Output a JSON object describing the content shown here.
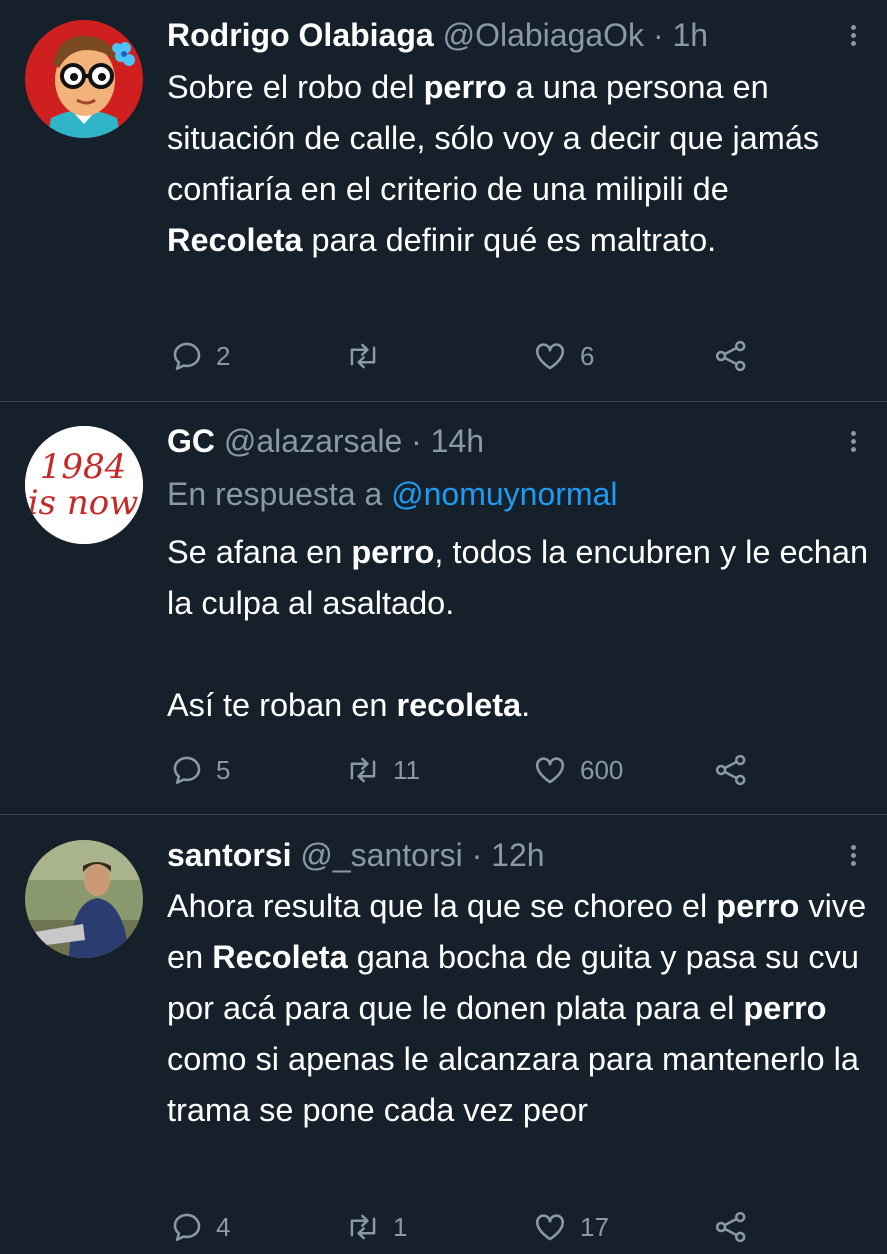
{
  "tweets": [
    {
      "name": "Rodrigo Olabiaga",
      "handle": "@OlabiagaOk",
      "separator": "·",
      "time": "1h",
      "replying_label": "",
      "replying_to": "",
      "body_paragraphs": [
        [
          {
            "text": "Sobre el robo del ",
            "bold": false
          },
          {
            "text": "perro",
            "bold": true
          },
          {
            "text": " a una persona en situación de calle, sólo voy a decir que jamás confiaría en el criterio de una milipili de ",
            "bold": false
          },
          {
            "text": "Recoleta",
            "bold": true
          },
          {
            "text": " para definir qué es maltrato.",
            "bold": false
          }
        ]
      ],
      "replies": "2",
      "retweets": "",
      "likes": "6",
      "avatar_icon": "cartoon-person-glasses-avatar"
    },
    {
      "name": "GC",
      "handle": "@alazarsale",
      "separator": "·",
      "time": "14h",
      "replying_label": "En respuesta a",
      "replying_to": "@nomuynormal",
      "body_paragraphs": [
        [
          {
            "text": "Se afana en ",
            "bold": false
          },
          {
            "text": "perro",
            "bold": true
          },
          {
            "text": ", todos la encubren y le echan la culpa al asaltado.",
            "bold": false
          }
        ],
        [
          {
            "text": "Así te roban en ",
            "bold": false
          },
          {
            "text": "recoleta",
            "bold": true
          },
          {
            "text": ".",
            "bold": false
          }
        ]
      ],
      "replies": "5",
      "retweets": "11",
      "likes": "600",
      "avatar_text_line1": "1984",
      "avatar_text_line2": "is now"
    },
    {
      "name": "santorsi",
      "handle": "@_santorsi",
      "separator": "·",
      "time": "12h",
      "replying_label": "",
      "replying_to": "",
      "body_paragraphs": [
        [
          {
            "text": "Ahora resulta que la que se choreo el ",
            "bold": false
          },
          {
            "text": "perro",
            "bold": true
          },
          {
            "text": " vive en ",
            "bold": false
          },
          {
            "text": "Recoleta",
            "bold": true
          },
          {
            "text": " gana bocha de guita y pasa su cvu por acá para que le donen plata para el ",
            "bold": false
          },
          {
            "text": "perro",
            "bold": true
          },
          {
            "text": " como si apenas le alcanzara para mantenerlo la trama se pone cada vez peor",
            "bold": false
          }
        ]
      ],
      "replies": "4",
      "retweets": "1",
      "likes": "17",
      "avatar_icon": "photo-person-avatar"
    }
  ],
  "colors": {
    "background": "#15202b",
    "text": "#ffffff",
    "secondary_text": "#8b98a5",
    "link": "#1d9bf0",
    "divider": "#38444d"
  },
  "icons": {
    "reply": "reply-icon",
    "retweet": "retweet-icon",
    "like": "heart-icon",
    "share": "share-icon",
    "more": "more-options-icon"
  }
}
